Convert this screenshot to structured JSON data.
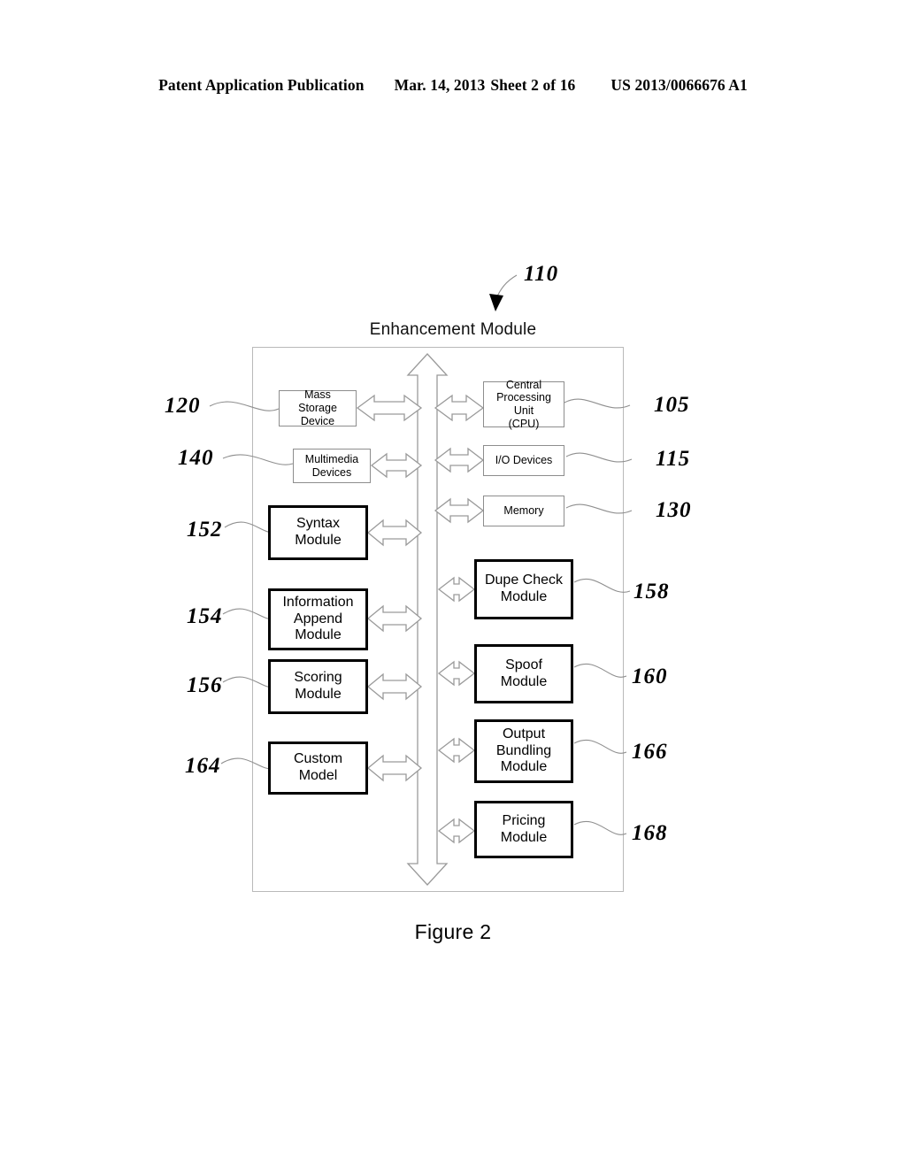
{
  "header": {
    "publication": "Patent Application Publication",
    "date": "Mar. 14, 2013",
    "sheet": "Sheet 2 of 16",
    "patent_number": "US 2013/0066676 A1"
  },
  "figure": {
    "caption": "Figure 2",
    "module_title": "Enhancement Module",
    "module_ref": "110",
    "bus_label": "system-bus"
  },
  "colors": {
    "ink": "#000000",
    "thin_border": "#8d8d8d",
    "container_border": "#b9b9b9",
    "arrow_stroke": "#9a9a9a",
    "leader_stroke": "#8f8f8f",
    "background": "#ffffff"
  },
  "left_column": [
    {
      "ref": "120",
      "label": "Mass Storage Device",
      "lines": [
        "Mass Storage",
        "Device"
      ],
      "weight": "thin"
    },
    {
      "ref": "140",
      "label": "Multimedia Devices",
      "lines": [
        "Multimedia",
        "Devices"
      ],
      "weight": "thin"
    },
    {
      "ref": "152",
      "label": "Syntax Module",
      "lines": [
        "Syntax Module"
      ],
      "weight": "thick"
    },
    {
      "ref": "154",
      "label": "Information Append Module",
      "lines": [
        "Information",
        "Append",
        "Module"
      ],
      "weight": "thick"
    },
    {
      "ref": "156",
      "label": "Scoring Module",
      "lines": [
        "Scoring",
        "Module"
      ],
      "weight": "thick"
    },
    {
      "ref": "164",
      "label": "Custom Model",
      "lines": [
        "Custom Model"
      ],
      "weight": "thick"
    }
  ],
  "right_column": [
    {
      "ref": "105",
      "label": "Central Processing Unit (CPU)",
      "lines": [
        "Central",
        "Processing Unit",
        "(CPU)"
      ],
      "weight": "thin"
    },
    {
      "ref": "115",
      "label": "I/O Devices",
      "lines": [
        "I/O Devices"
      ],
      "weight": "thin"
    },
    {
      "ref": "130",
      "label": "Memory",
      "lines": [
        "Memory"
      ],
      "weight": "thin"
    },
    {
      "ref": "158",
      "label": "Dupe Check Module",
      "lines": [
        "Dupe Check",
        "Module"
      ],
      "weight": "thick"
    },
    {
      "ref": "160",
      "label": "Spoof Module",
      "lines": [
        "Spoof Module"
      ],
      "weight": "thick"
    },
    {
      "ref": "166",
      "label": "Output Bundling Module",
      "lines": [
        "Output",
        "Bundling",
        "Module"
      ],
      "weight": "thick"
    },
    {
      "ref": "168",
      "label": "Pricing Module",
      "lines": [
        "Pricing Module"
      ],
      "weight": "thick"
    }
  ]
}
